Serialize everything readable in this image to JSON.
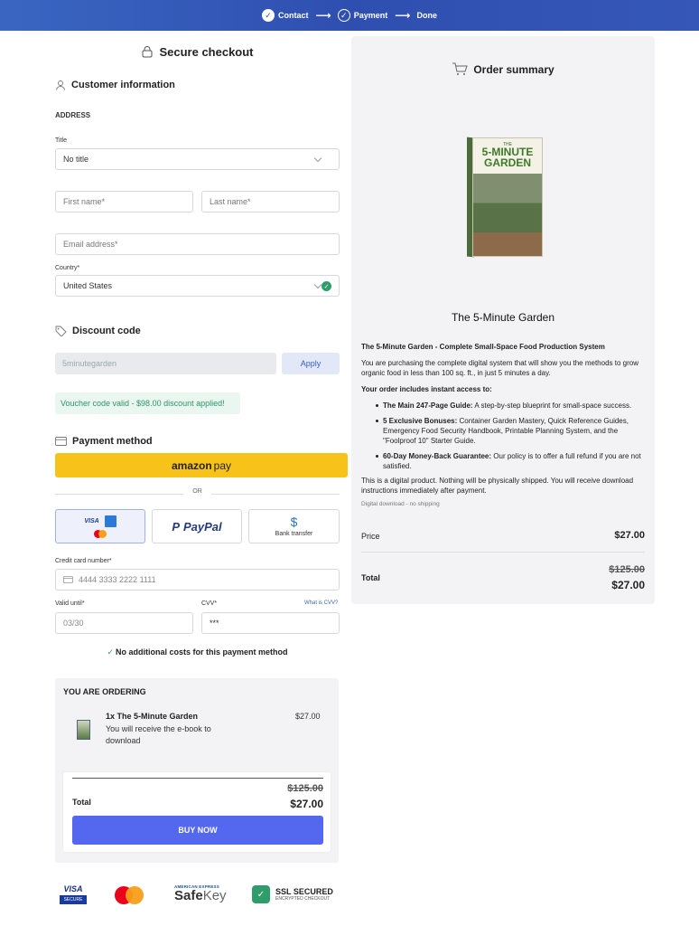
{
  "progress": {
    "steps": [
      {
        "label": "Contact"
      },
      {
        "label": "Payment"
      },
      {
        "label": "Done"
      }
    ]
  },
  "checkout": {
    "title": "Secure checkout",
    "customer_heading": "Customer information",
    "address_label": "ADDRESS",
    "title_label": "Title",
    "title_value": "No title",
    "first_name_placeholder": "First name*",
    "last_name_placeholder": "Last name*",
    "email_placeholder": "Email address*",
    "country_label": "Country*",
    "country_value": "United States",
    "discount_heading": "Discount code",
    "discount_value": "5minutegarden",
    "apply_label": "Apply",
    "voucher_message": "Voucher code valid - $98.00 discount applied!",
    "payment_heading": "Payment method",
    "amazon_pay": {
      "brand": "amazon",
      "suffix": "pay"
    },
    "or_label": "OR",
    "payment_options": {
      "card_visa": "VISA",
      "paypal": "PayPal",
      "bank": "Bank transfer"
    },
    "card_number_label": "Credit card number*",
    "card_number_value": "4444 3333 2222 1111",
    "valid_until_label": "Valid until*",
    "valid_until_value": "03/30",
    "cvv_label": "CVV*",
    "cvv_value": "***",
    "cvv_link": "What is CVV?",
    "no_extra_costs": "No additional costs for this payment method"
  },
  "ordering": {
    "heading": "YOU ARE ORDERING",
    "item_title": "1x The 5-Minute Garden",
    "item_desc": "You will receive the e-book to download",
    "item_price": "$27.00",
    "total_label": "Total",
    "old_total": "$125.00",
    "new_total": "$27.00",
    "buy_label": "BUY NOW"
  },
  "trust": {
    "visa": "VISA",
    "visa_sub": "SECURE",
    "amex_top": "AMERICAN EXPRESS",
    "safekey_a": "Safe",
    "safekey_b": "Key",
    "ssl": "SSL SECURED",
    "ssl_sub": "ENCRYPTED CHECKOUT"
  },
  "summary": {
    "heading": "Order summary",
    "book_cover": {
      "small": "THE",
      "line1": "5-MINUTE",
      "line2": "GARDEN"
    },
    "product_title": "The 5-Minute Garden",
    "subtitle": "The 5-Minute Garden - Complete Small-Space Food Production System",
    "intro": "You are purchasing the complete digital system that will show you the methods to grow organic food in less than 100 sq. ft., in just 5 minutes a day.",
    "access_heading": "Your order includes instant access to:",
    "items": [
      {
        "bold": "The Main 247-Page Guide:",
        "text": " A step-by-step blueprint for small-space success."
      },
      {
        "bold": "5 Exclusive Bonuses:",
        "text": " Container Garden Mastery, Quick Reference Guides, Emergency Food Security Handbook, Printable Planning System, and the \"Foolproof 10\" Starter Guide."
      },
      {
        "bold": "60-Day Money-Back Guarantee:",
        "text": " Our policy is to offer a full refund if you are not satisfied."
      }
    ],
    "digital_note": "This is a digital product. Nothing will be physically shipped. You will receive download instructions immediately after payment.",
    "shipping_note": "Digital download - no shipping",
    "price_label": "Price",
    "price_value": "$27.00",
    "total_label": "Total",
    "old_total": "$125.00",
    "new_total": "$27.00"
  },
  "colors": {
    "accent": "#5368ee",
    "banner": "#2f4fb0",
    "success": "#2e9d6a",
    "amazon_yellow": "#f7c21a"
  }
}
